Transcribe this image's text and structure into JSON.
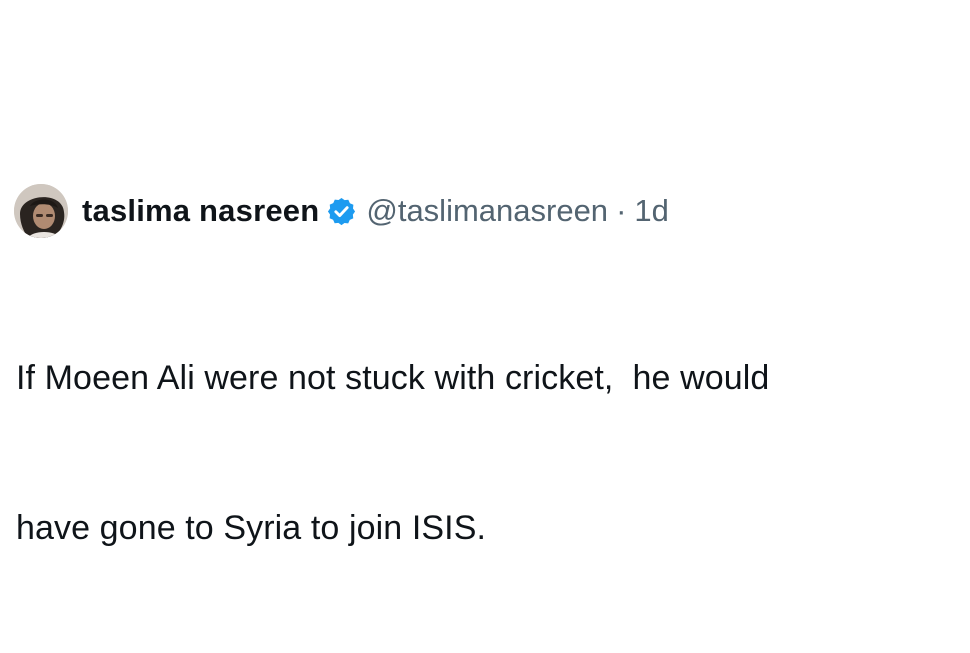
{
  "tweet": {
    "author": {
      "display_name": "taslima nasreen",
      "handle": "@taslimanasreen",
      "verified": true,
      "avatar_icon": "profile-photo"
    },
    "separator": "·",
    "timestamp": "1d",
    "text_lines": [
      "If Moeen Ali were not stuck with cricket,  he would",
      "have gone to Syria to join ISIS."
    ]
  },
  "colors": {
    "text_primary": "#0f1419",
    "text_secondary": "#536471",
    "verified_badge": "#1d9bf0",
    "background": "#ffffff"
  }
}
